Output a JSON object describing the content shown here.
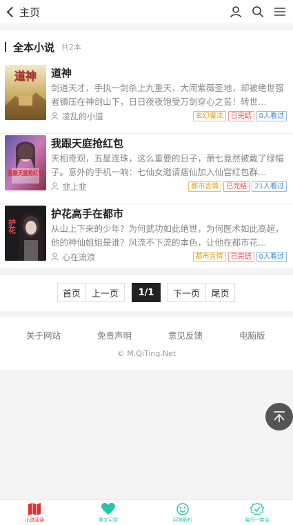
{
  "header": {
    "back_label": "主页",
    "icons": [
      "user-icon",
      "search-icon",
      "menu-icon"
    ]
  },
  "section": {
    "title": "全本小说",
    "count": "共2本"
  },
  "books": [
    {
      "title": "道神",
      "description": "剑道天才，手执一剑杀上九重天，大闹紫薇圣地，却被绝世强者镇压在神剑山下，日日夜夜饱受万剑穿心之苦！转世…",
      "author": "凌乱的小道",
      "category": "玄幻魔法",
      "status": "已完结",
      "views": "0人看过",
      "cover_text": "道神"
    },
    {
      "title": "我跟天庭抢红包",
      "description": "天相奇观，五星连珠，这么重要的日子，萧七竟然被戴了绿帽子。意外的手机一响：七仙女邀请痞仙加入仙宫红包群…",
      "author": "韭上韭",
      "category": "都市言情",
      "status": "已完结",
      "views": "21人看过",
      "cover_text": "我跟天庭抢红包"
    },
    {
      "title": "护花高手在都市",
      "description": "从山上下来的少年？为何武功如此绝世，为何医术如此高超，他的神仙姐姐是谁？风流不下流的本色，让他在都市花…",
      "author": "心在流浪",
      "category": "都市言情",
      "status": "已完结",
      "views": "0人看过",
      "cover_text": "护花"
    }
  ],
  "pager": {
    "first": "首页",
    "prev": "上一页",
    "current": "1/1",
    "next": "下一页",
    "last": "尾页"
  },
  "footer": {
    "links": [
      "关于网站",
      "免责声明",
      "意见反馈",
      "电脑版"
    ],
    "copyright": "© M.QiTing.Net"
  },
  "tabbar": {
    "tabs": [
      {
        "label": "小说阅读",
        "icon": "book-icon",
        "color": "#e03030"
      },
      {
        "label": "美文可赏",
        "icon": "heart-icon",
        "color": "#25c6b0"
      },
      {
        "label": "问答解析",
        "icon": "smile-icon",
        "color": "#25c6b0"
      },
      {
        "label": "每日一笑谈",
        "icon": "badge-check-icon",
        "color": "#25c6b0"
      }
    ]
  }
}
